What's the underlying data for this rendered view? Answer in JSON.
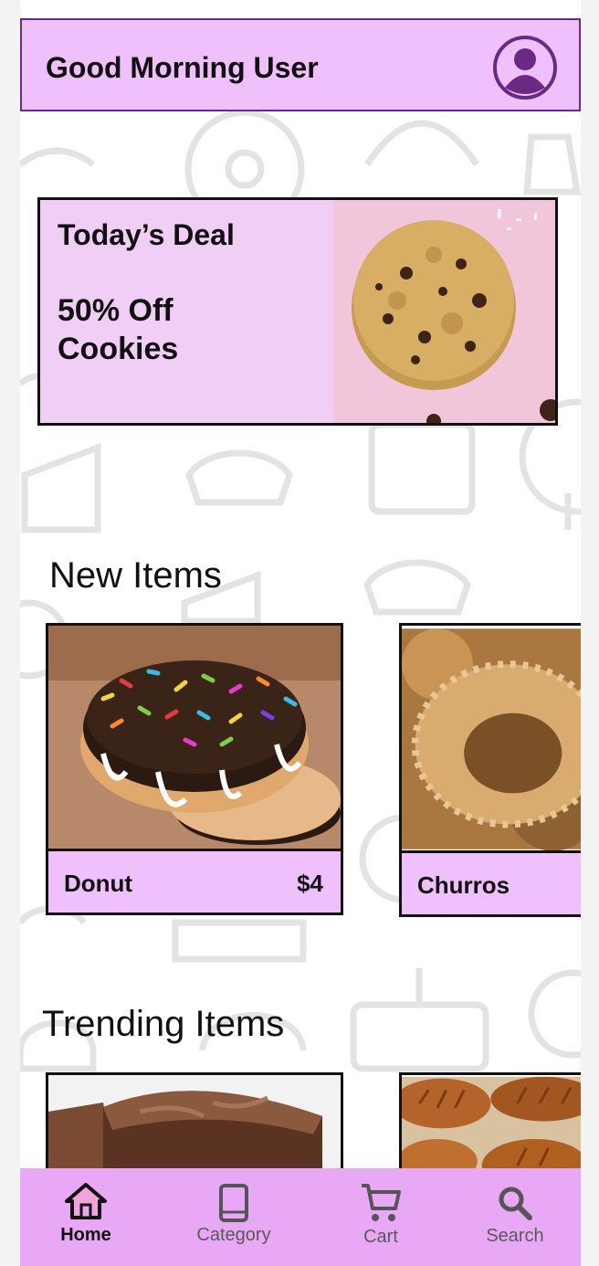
{
  "header": {
    "greeting": "Good Morning User",
    "avatar_icon": "user-circle-icon"
  },
  "deal": {
    "title": "Today’s Deal",
    "offer": "50% Off Cookies",
    "image": "cookie-photo"
  },
  "new_items": {
    "title": "New Items",
    "items": [
      {
        "name": "Donut",
        "price": "$4",
        "image": "donut-photo"
      },
      {
        "name": "Churros",
        "price": "",
        "image": "churros-photo"
      }
    ]
  },
  "trending_items": {
    "title": "Trending Items",
    "items": [
      {
        "image": "brownie-photo"
      },
      {
        "image": "croissant-photo"
      }
    ]
  },
  "nav": {
    "items": [
      {
        "label": "Home",
        "icon": "home-icon",
        "active": true
      },
      {
        "label": "Category",
        "icon": "book-icon",
        "active": false
      },
      {
        "label": "Cart",
        "icon": "cart-icon",
        "active": false
      },
      {
        "label": "Search",
        "icon": "search-icon",
        "active": false
      }
    ]
  },
  "colors": {
    "header_bg": "#efc0fb",
    "header_border": "#6a2a84",
    "deal_bg": "#f1cef5",
    "nav_bg": "#e9a8f6",
    "accent_purple": "#6a2a84"
  }
}
